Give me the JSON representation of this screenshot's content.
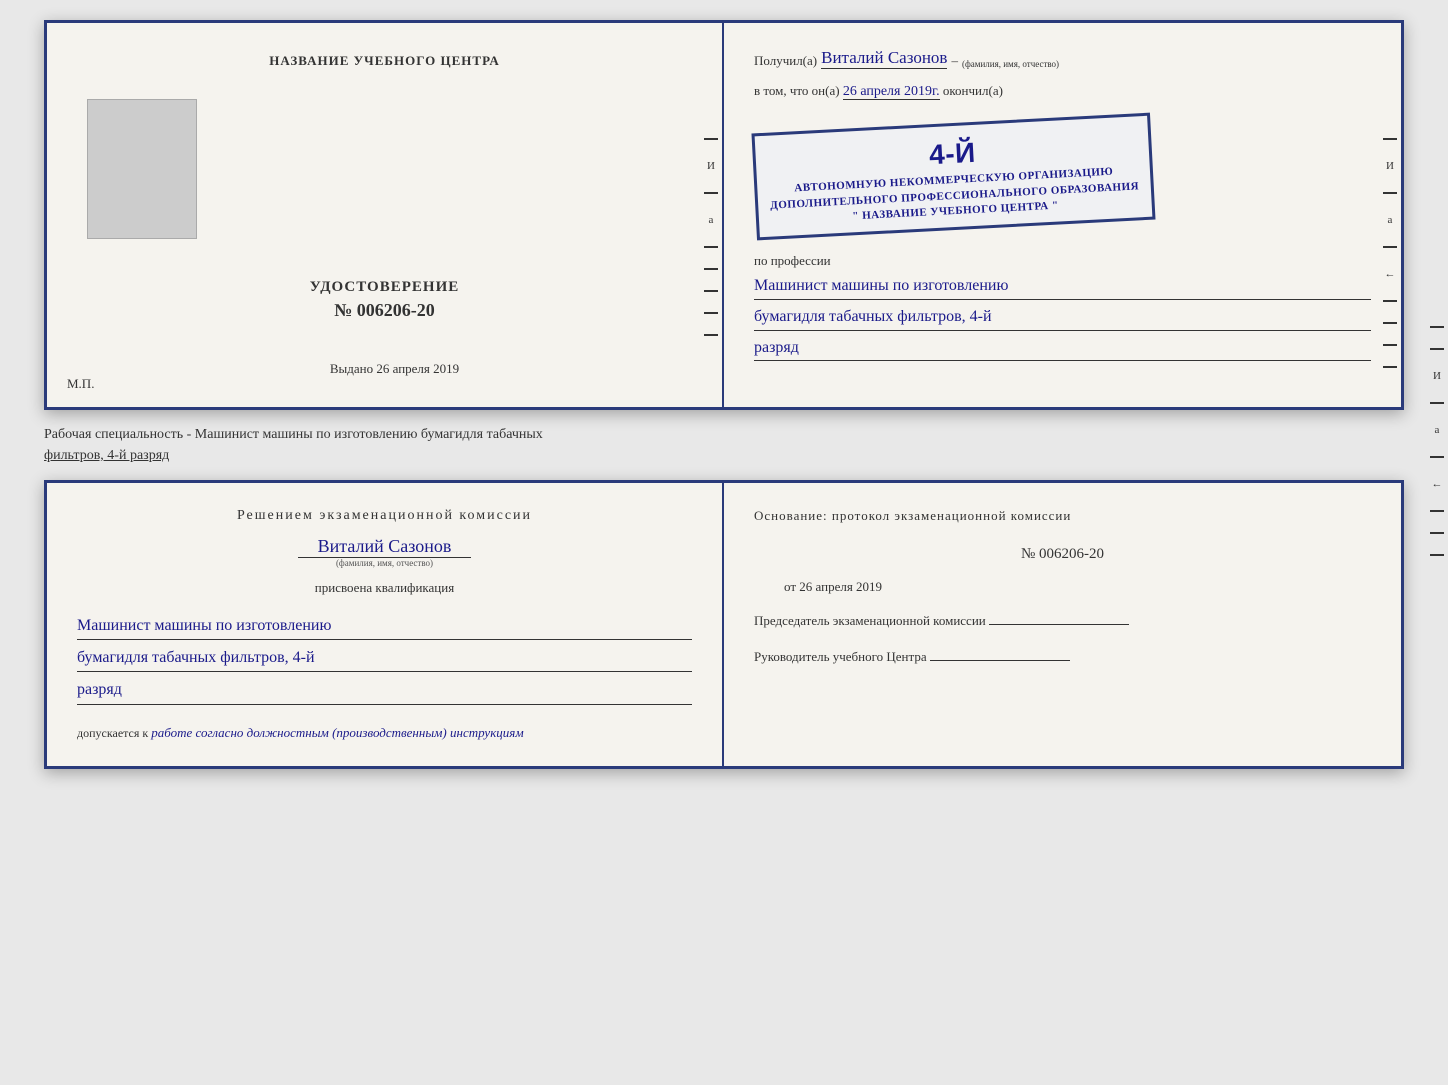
{
  "top_booklet": {
    "left": {
      "title": "НАЗВАНИЕ УЧЕБНОГО ЦЕНТРА",
      "udostoverenie_label": "УДОСТОВЕРЕНИЕ",
      "udostoverenie_number": "№ 006206-20",
      "vydano_label": "Выдано",
      "vydano_date": "26 апреля 2019",
      "mp_label": "М.П."
    },
    "right": {
      "poluchil_prefix": "Получил(а)",
      "recipient_name": "Виталий Сазонов",
      "recipient_subtitle": "(фамилия, имя, отчество)",
      "dash": "–",
      "vtom_prefix": "в том, что он(а)",
      "vtom_date": "26 апреля 2019г.",
      "okonchil": "окончил(а)",
      "stamp_number": "4-й",
      "stamp_line1": "АВТОНОМНУЮ НЕКОММЕРЧЕСКУЮ ОРГАНИЗАЦИЮ",
      "stamp_line2": "ДОПОЛНИТЕЛЬНОГО ПРОФЕССИОНАЛЬНОГО ОБРАЗОВАНИЯ",
      "stamp_line3": "\" НАЗВАНИЕ УЧЕБНОГО ЦЕНТРА \"",
      "po_professii": "по профессии",
      "profession_line1": "Машинист машины по изготовлению",
      "profession_line2": "бумагидля табачных фильтров, 4-й",
      "profession_line3": "разряд"
    }
  },
  "specialty_text": "Рабочая специальность - Машинист машины по изготовлению бумагидля табачных",
  "specialty_underline": "фильтров, 4-й разряд",
  "bottom_booklet": {
    "left": {
      "decision_title": "Решением  экзаменационной  комиссии",
      "name": "Виталий Сазонов",
      "name_subtitle": "(фамилия, имя, отчество)",
      "prisvoena_label": "присвоена квалификация",
      "qualification_line1": "Машинист машины по изготовлению",
      "qualification_line2": "бумагидля табачных фильтров, 4-й",
      "qualification_line3": "разряд",
      "dopuskaetsya_label": "допускается к",
      "dopuskaetsya_text": "работе согласно должностным (производственным) инструкциям"
    },
    "right": {
      "osnov_label": "Основание: протокол экзаменационной  комиссии",
      "protocol_number": "№  006206-20",
      "ot_prefix": "от",
      "ot_date": "26 апреля 2019",
      "predsedatel_label": "Председатель экзаменационной комиссии",
      "rukovoditel_label": "Руководитель учебного Центра"
    }
  }
}
